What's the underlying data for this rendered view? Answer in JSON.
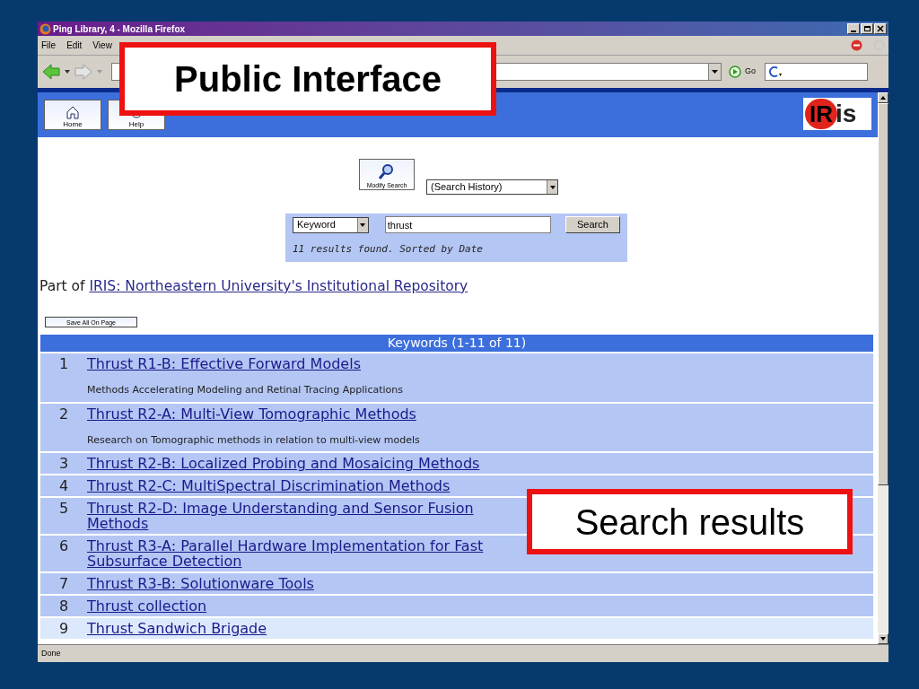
{
  "window": {
    "title": "Ping Library, 4 - Mozilla Firefox"
  },
  "menu": [
    "File",
    "Edit",
    "View"
  ],
  "toolbar": {
    "go_label": "Go"
  },
  "header_buttons": [
    "Home",
    "Help"
  ],
  "logo": {
    "mark": "IR",
    "rest": "is"
  },
  "search": {
    "modify_label": "Modify Search",
    "history": "(Search History)",
    "field_type": "Keyword",
    "query": "thrust",
    "button": "Search",
    "summary": "11 results found. Sorted by Date"
  },
  "part_of": {
    "prefix": "Part of",
    "link": "IRIS: Northeastern University's Institutional Repository"
  },
  "save_button": "Save All On Page",
  "results": {
    "heading": "Keywords (1-11 of 11)",
    "rows": [
      {
        "number": "1",
        "title": "Thrust R1-B: Effective Forward Models",
        "description": "Methods Accelerating Modeling and Retinal Tracing Applications",
        "highlighted": false
      },
      {
        "number": "2",
        "title": "Thrust R2-A: Multi-View Tomographic Methods",
        "description": "Research on Tomographic methods in relation to multi-view models",
        "highlighted": false
      },
      {
        "number": "3",
        "title": "Thrust R2-B: Localized Probing and Mosaicing Methods",
        "highlighted": false
      },
      {
        "number": "4",
        "title": "Thrust R2-C: MultiSpectral Discrimination Methods",
        "highlighted": false
      },
      {
        "number": "5",
        "title": "Thrust R2-D: Image Understanding and Sensor Fusion Methods",
        "highlighted": false
      },
      {
        "number": "6",
        "title": "Thrust R3-A: Parallel Hardware Implementation for Fast Subsurface Detection",
        "highlighted": false
      },
      {
        "number": "7",
        "title": "Thrust R3-B: Solutionware Tools",
        "highlighted": false
      },
      {
        "number": "8",
        "title": "Thrust collection",
        "highlighted": false
      },
      {
        "number": "9",
        "title": "Thrust Sandwich Brigade",
        "highlighted": true
      }
    ]
  },
  "status_bar": "Done",
  "callouts": [
    {
      "text": "Public Interface"
    },
    {
      "text": "Search results"
    }
  ]
}
